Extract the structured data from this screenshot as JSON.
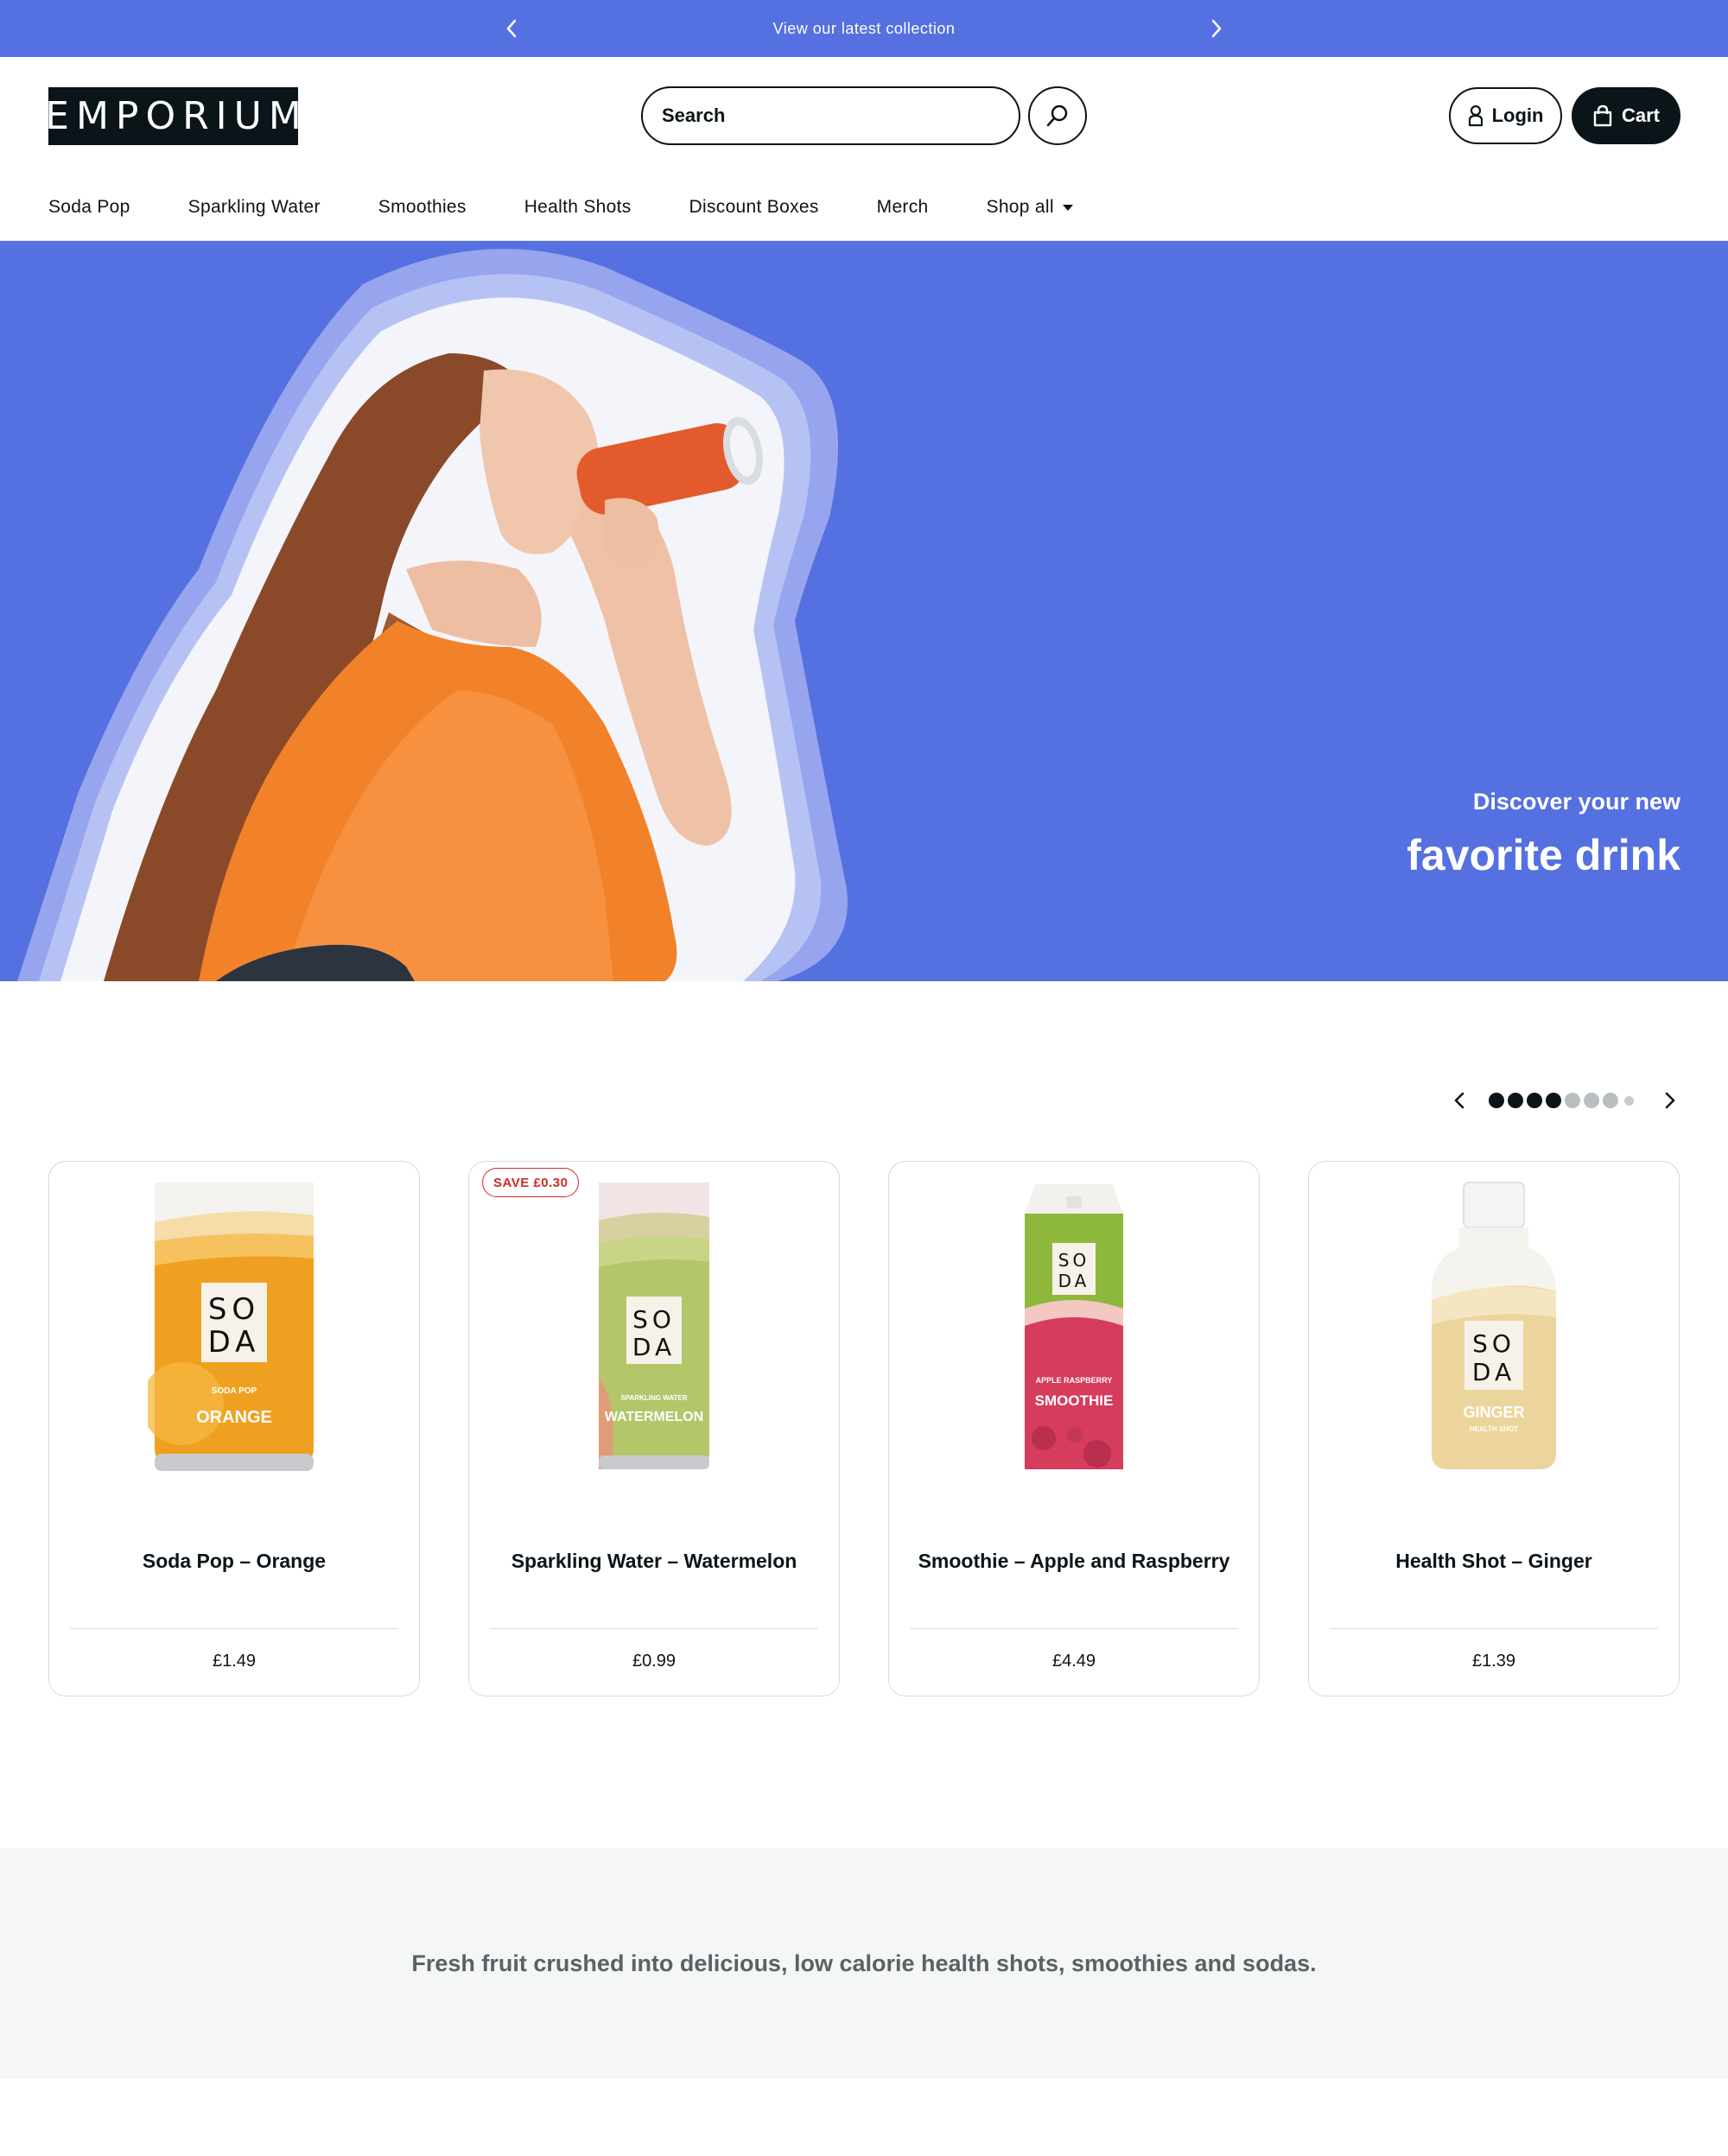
{
  "announcement": {
    "message": "View our latest collection",
    "prev_icon": "chevron-left-icon",
    "next_icon": "chevron-right-icon"
  },
  "header": {
    "logo": "EMPORIUM",
    "search_placeholder": "Search",
    "login_label": "Login",
    "cart_label": "Cart"
  },
  "nav": {
    "items": [
      "Soda Pop",
      "Sparkling Water",
      "Smoothies",
      "Health Shots",
      "Discount Boxes",
      "Merch"
    ],
    "shop_all": "Shop all"
  },
  "hero": {
    "subtitle": "Discover your new",
    "title": "favorite drink"
  },
  "carousel": {
    "dots_total": 8,
    "active_dots": 4
  },
  "products": [
    {
      "title": "Soda Pop – Orange",
      "price": "£1.49",
      "badge": "",
      "pack": {
        "l1": "SO",
        "l2": "DA",
        "cat": "SODA POP",
        "flavor": "ORANGE"
      }
    },
    {
      "title": "Sparkling Water – Watermelon",
      "price": "£0.99",
      "badge": "SAVE £0.30",
      "pack": {
        "l1": "SO",
        "l2": "DA",
        "cat": "SPARKLING WATER",
        "flavor": "WATERMELON"
      }
    },
    {
      "title": "Smoothie – Apple and Raspberry",
      "price": "£4.49",
      "badge": "",
      "pack": {
        "l1": "SO",
        "l2": "DA",
        "cat": "APPLE RASPBERRY",
        "flavor": "SMOOTHIE"
      }
    },
    {
      "title": "Health Shot – Ginger",
      "price": "£1.39",
      "badge": "",
      "pack": {
        "l1": "SO",
        "l2": "DA",
        "cat": "HEALTH SHOT",
        "flavor": "GINGER"
      }
    }
  ],
  "tagline": "Fresh fruit crushed into delicious, low calorie health shots, smoothies and sodas.",
  "colors": {
    "brand_blue": "#5570e0",
    "dark": "#0b1418",
    "badge_red": "#d12a2a",
    "strip_bg": "#f5f6f6"
  }
}
